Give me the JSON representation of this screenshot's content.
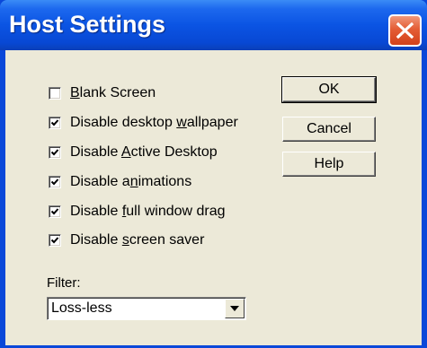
{
  "window": {
    "title": "Host Settings"
  },
  "checkboxes": [
    {
      "pre": "",
      "mnemonic": "B",
      "post": "lank Screen",
      "checked": false
    },
    {
      "pre": "Disable desktop ",
      "mnemonic": "w",
      "post": "allpaper",
      "checked": true
    },
    {
      "pre": "Disable ",
      "mnemonic": "A",
      "post": "ctive Desktop",
      "checked": true
    },
    {
      "pre": "Disable a",
      "mnemonic": "n",
      "post": "imations",
      "checked": true
    },
    {
      "pre": "Disable ",
      "mnemonic": "f",
      "post": "ull window drag",
      "checked": true
    },
    {
      "pre": "Disable ",
      "mnemonic": "s",
      "post": "creen saver",
      "checked": true
    }
  ],
  "buttons": {
    "ok": "OK",
    "cancel": "Cancel",
    "help": "Help"
  },
  "filter": {
    "label": "Filter:",
    "value": "Loss-less"
  },
  "icons": {
    "close": "close-icon",
    "check": "checkmark-icon",
    "dropdown": "chevron-down-icon"
  },
  "colors": {
    "titlebar": "#0b54e3",
    "close_button": "#d3411a",
    "dialog_background": "#ece9d8"
  }
}
